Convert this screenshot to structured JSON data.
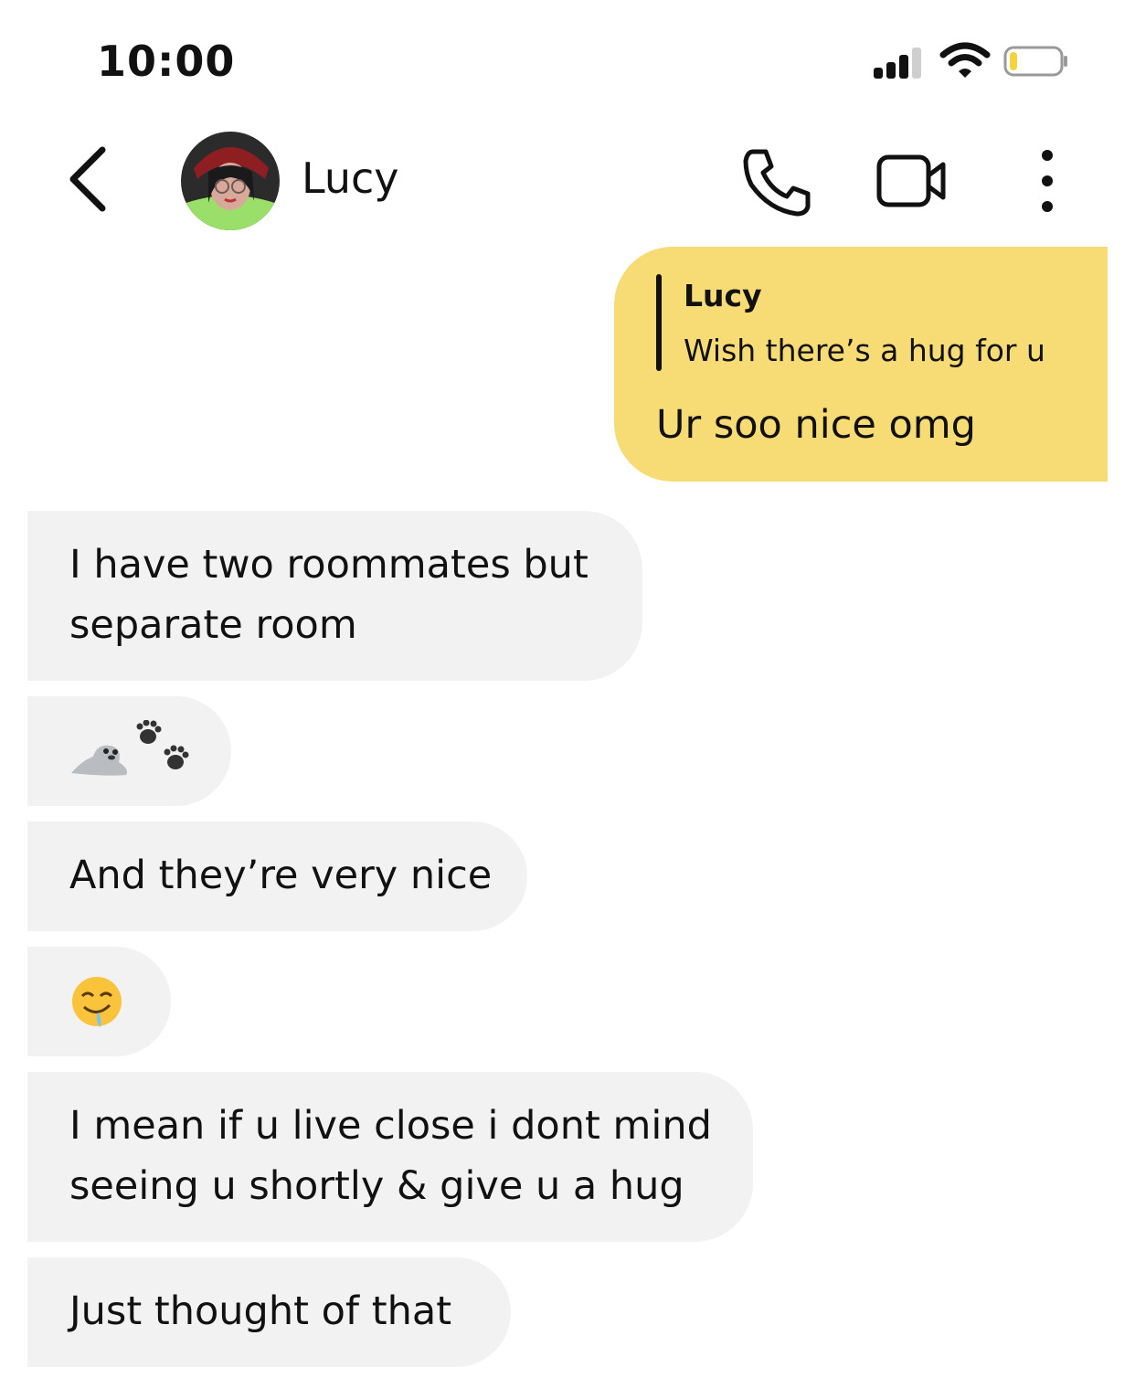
{
  "status_bar": {
    "time": "10:00",
    "battery_level": 0.15
  },
  "header": {
    "contact_name": "Lucy"
  },
  "messages": {
    "sent_1": {
      "quote_author": "Lucy",
      "quote_text": "Wish there’s a hug for u",
      "text": "Ur soo nice omg"
    },
    "recv_1": {
      "text": "I have two roommates but\nseparate room"
    },
    "recv_2": {
      "emoji": [
        "seal-emoji",
        "paw-prints-emoji"
      ]
    },
    "recv_3": {
      "text": "And they’re very nice"
    },
    "recv_4": {
      "emoji": [
        "drooling-face-emoji"
      ]
    },
    "recv_5": {
      "text": "I mean if u live close i dont mind\nseeing u shortly & give u a hug"
    },
    "recv_6": {
      "text": "Just thought of that"
    }
  },
  "colors": {
    "sent_bubble": "#f7dc76",
    "received_bubble": "#f2f2f2",
    "battery_fill": "#f5d33a"
  }
}
